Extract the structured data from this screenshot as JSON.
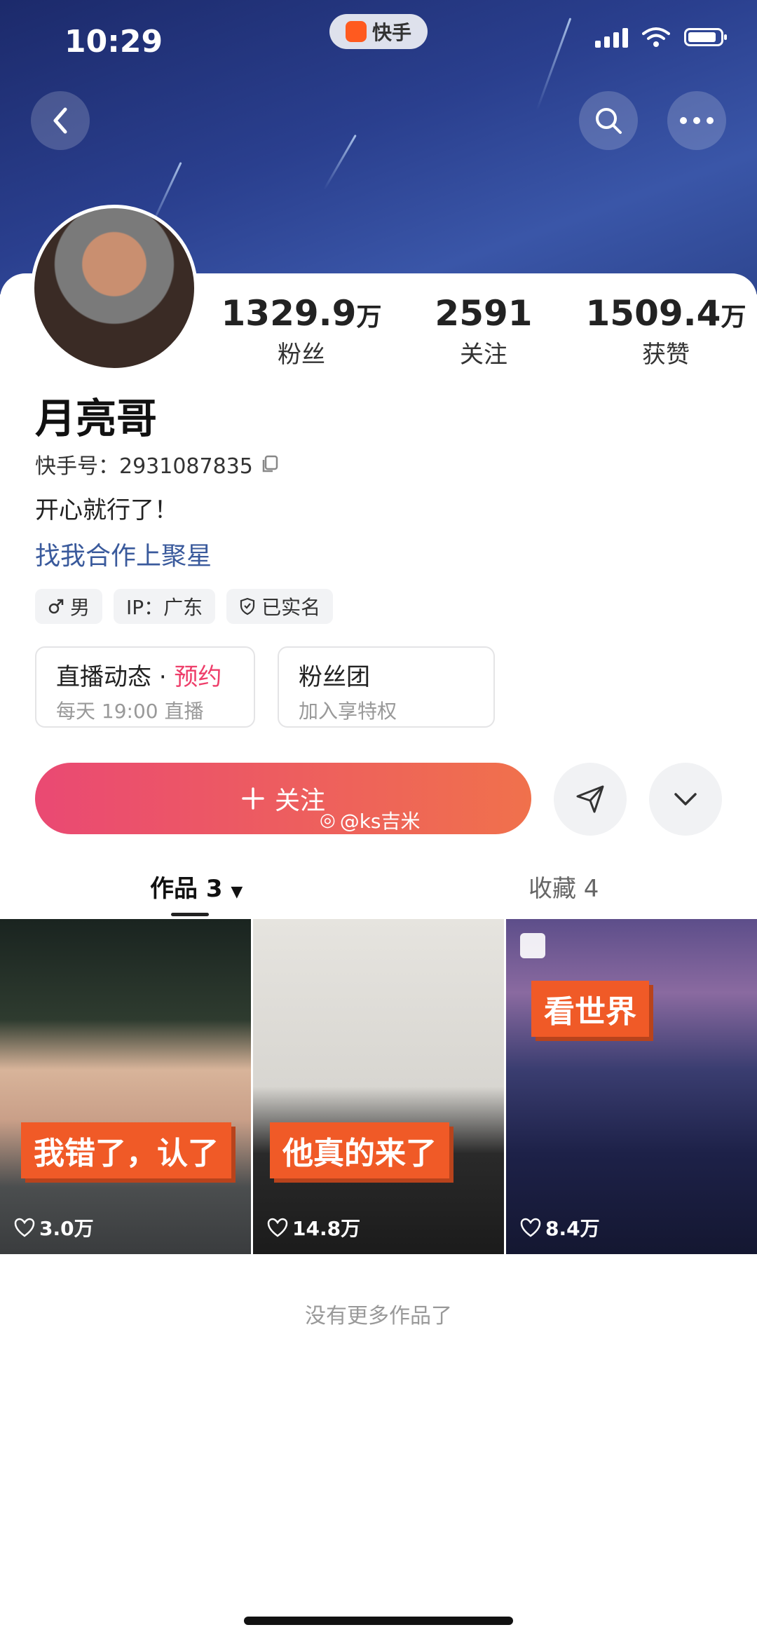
{
  "status_bar": {
    "time": "10:29"
  },
  "app_badge": {
    "label": "快手"
  },
  "profile": {
    "name": "月亮哥",
    "uid_label": "快手号：2931087835",
    "bio": "开心就行了！",
    "cooperation_link": "找我合作上聚星",
    "stats": [
      {
        "value": "1329.9",
        "unit": "万",
        "label": "粉丝"
      },
      {
        "value": "2591",
        "unit": "",
        "label": "关注"
      },
      {
        "value": "1509.4",
        "unit": "万",
        "label": "获赞"
      }
    ],
    "tags": {
      "gender": "男",
      "ip": "IP：广东",
      "verified": "已实名"
    }
  },
  "cards": {
    "live": {
      "title": "直播动态",
      "dot": "·",
      "action": "预约",
      "subtitle": "每天 19:00 直播"
    },
    "fanclub": {
      "title": "粉丝团",
      "subtitle": "加入享特权"
    }
  },
  "follow_button": {
    "label": "关注"
  },
  "watermark": {
    "text": "@ks吉米"
  },
  "tabs": {
    "works": "作品 3",
    "favorites": "收藏 4"
  },
  "works": [
    {
      "caption": "我错了，认了",
      "likes": "3.0万"
    },
    {
      "caption": "他真的来了",
      "likes": "14.8万"
    },
    {
      "caption": "看世界",
      "likes": "8.4万"
    }
  ],
  "footer_text": "没有更多作品了",
  "colors": {
    "accent_pink": "#ee3e6a",
    "follow_gradient_start": "#ea4973",
    "follow_gradient_end": "#f0714c",
    "link_blue": "#3a5a9c",
    "caption_orange": "#f05a27"
  }
}
